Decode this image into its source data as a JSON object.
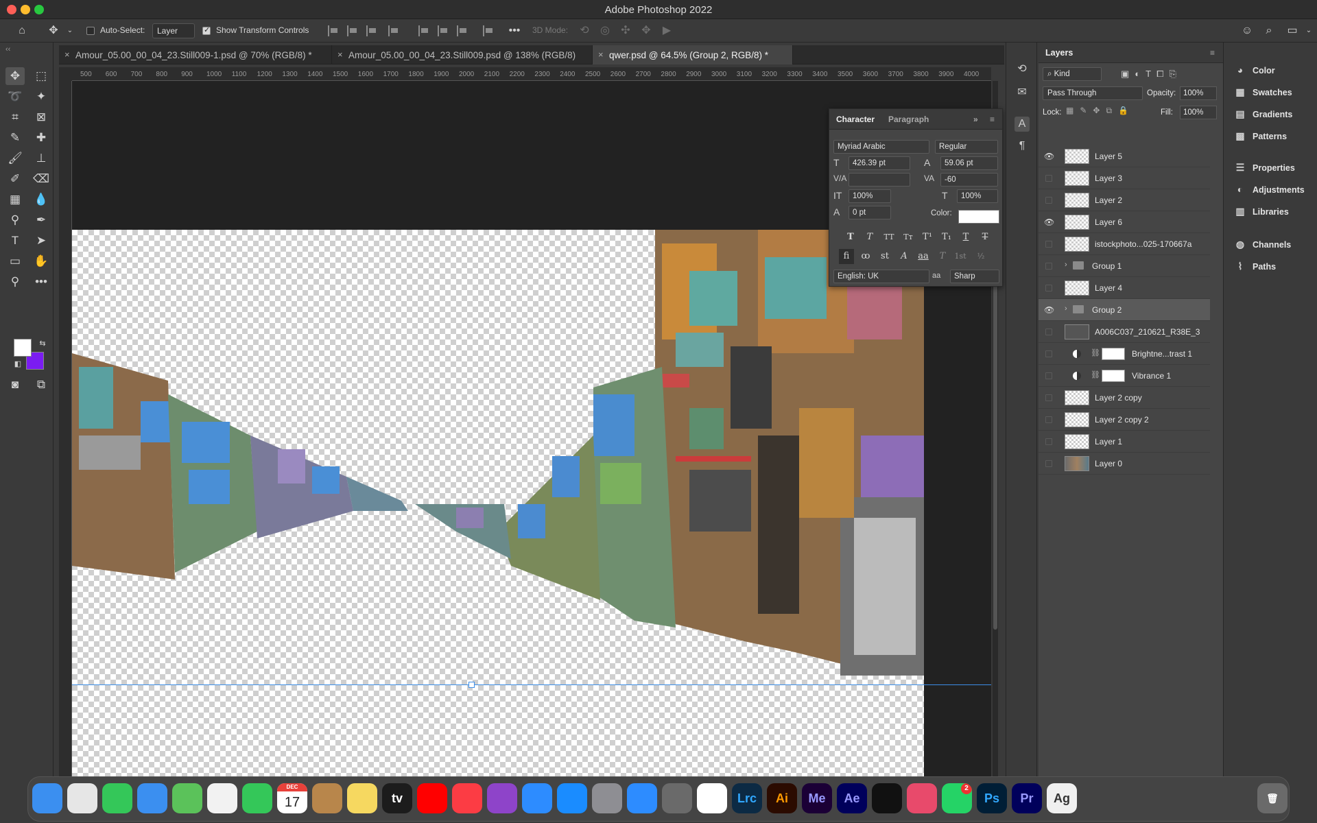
{
  "window": {
    "title": "Adobe Photoshop 2022"
  },
  "options_bar": {
    "auto_select_label": "Auto-Select:",
    "auto_select_value": "Layer",
    "show_transform_label": "Show Transform Controls",
    "mode_3d_label": "3D Mode:"
  },
  "tabs": [
    {
      "label": "Amour_05.00_00_04_23.Still009-1.psd @ 70% (RGB/8) *"
    },
    {
      "label": "Amour_05.00_00_04_23.Still009.psd @ 138% (RGB/8)"
    },
    {
      "label": "qwer.psd @ 64.5% (Group 2, RGB/8) *"
    }
  ],
  "ruler": {
    "h_ticks": [
      "500",
      "600",
      "700",
      "800",
      "900",
      "1000",
      "1100",
      "1200",
      "1300",
      "1400",
      "1500",
      "1600",
      "1700",
      "1800",
      "1900",
      "2000",
      "2100",
      "2200",
      "2300",
      "2400",
      "2500",
      "2600",
      "2700",
      "2800",
      "2900",
      "3000",
      "3100",
      "3200",
      "3300",
      "3400",
      "3500",
      "3600",
      "3700",
      "3800",
      "3900",
      "4000"
    ]
  },
  "character_panel": {
    "tab_character": "Character",
    "tab_paragraph": "Paragraph",
    "font_family": "Myriad Arabic",
    "font_style": "Regular",
    "font_size": "426.39 pt",
    "leading": "59.06 pt",
    "kerning": "",
    "tracking": "-60",
    "vertical_scale": "100%",
    "horizontal_scale": "100%",
    "baseline_shift": "0 pt",
    "color_label": "Color:",
    "language": "English: UK",
    "antialias": "Sharp",
    "antialias_icon": "aa"
  },
  "layers_panel": {
    "title": "Layers",
    "filter_kind": "Kind",
    "blend_mode": "Pass Through",
    "opacity_label": "Opacity:",
    "opacity_value": "100%",
    "lock_label": "Lock:",
    "fill_label": "Fill:",
    "fill_value": "100%",
    "layers": [
      {
        "name": "Layer 5",
        "visible": true,
        "type": "pixel"
      },
      {
        "name": "Layer 3",
        "visible": false,
        "type": "pixel"
      },
      {
        "name": "Layer 2",
        "visible": false,
        "type": "pixel"
      },
      {
        "name": "Layer 6",
        "visible": true,
        "type": "pixel"
      },
      {
        "name": "istockphoto...025-170667a",
        "visible": false,
        "type": "pixel"
      },
      {
        "name": "Group 1",
        "visible": false,
        "type": "group"
      },
      {
        "name": "Layer 4",
        "visible": false,
        "type": "pixel"
      },
      {
        "name": "Group 2",
        "visible": true,
        "type": "group",
        "selected": true
      },
      {
        "name": "A006C037_210621_R38E_3",
        "visible": false,
        "type": "photo"
      },
      {
        "name": "Brightne...trast 1",
        "visible": false,
        "type": "adjustment"
      },
      {
        "name": "Vibrance 1",
        "visible": false,
        "type": "adjustment"
      },
      {
        "name": "Layer 2 copy",
        "visible": false,
        "type": "pixel"
      },
      {
        "name": "Layer 2 copy 2",
        "visible": false,
        "type": "pixel"
      },
      {
        "name": "Layer 1",
        "visible": false,
        "type": "pixel"
      },
      {
        "name": "Layer 0",
        "visible": false,
        "type": "photo"
      }
    ]
  },
  "right_panels": [
    "Color",
    "Swatches",
    "Gradients",
    "Patterns",
    "Properties",
    "Adjustments",
    "Libraries",
    "Channels",
    "Paths"
  ],
  "colors": {
    "foreground": "#ffffff",
    "background": "#7b1cf2",
    "guide": "#3d8ee8"
  },
  "dock": {
    "calendar_month": "DEC",
    "calendar_day": "17",
    "apps": [
      {
        "label": "Finder"
      },
      {
        "label": "Launchpad"
      },
      {
        "label": "Messages"
      },
      {
        "label": "Mail"
      },
      {
        "label": "Maps"
      },
      {
        "label": "Photos"
      },
      {
        "label": "FaceTime"
      },
      {
        "label": "Calendar"
      },
      {
        "label": "Contacts"
      },
      {
        "label": "Notes"
      },
      {
        "label": "tv"
      },
      {
        "label": "YouTube"
      },
      {
        "label": "Music"
      },
      {
        "label": "Podcasts"
      },
      {
        "label": "Zoom"
      },
      {
        "label": "App Store"
      },
      {
        "label": "System Preferences"
      },
      {
        "label": "Safari"
      },
      {
        "label": "QuickTime"
      },
      {
        "label": "Chrome"
      },
      {
        "label": "Lrc"
      },
      {
        "label": "Ai"
      },
      {
        "label": "Me"
      },
      {
        "label": "Ae"
      },
      {
        "label": "Cinema 4D"
      },
      {
        "label": "Creative Cloud"
      },
      {
        "label": "WhatsApp"
      },
      {
        "label": "Ps"
      },
      {
        "label": "Pr"
      },
      {
        "label": "Ag"
      }
    ],
    "whatsapp_badge": "2"
  }
}
